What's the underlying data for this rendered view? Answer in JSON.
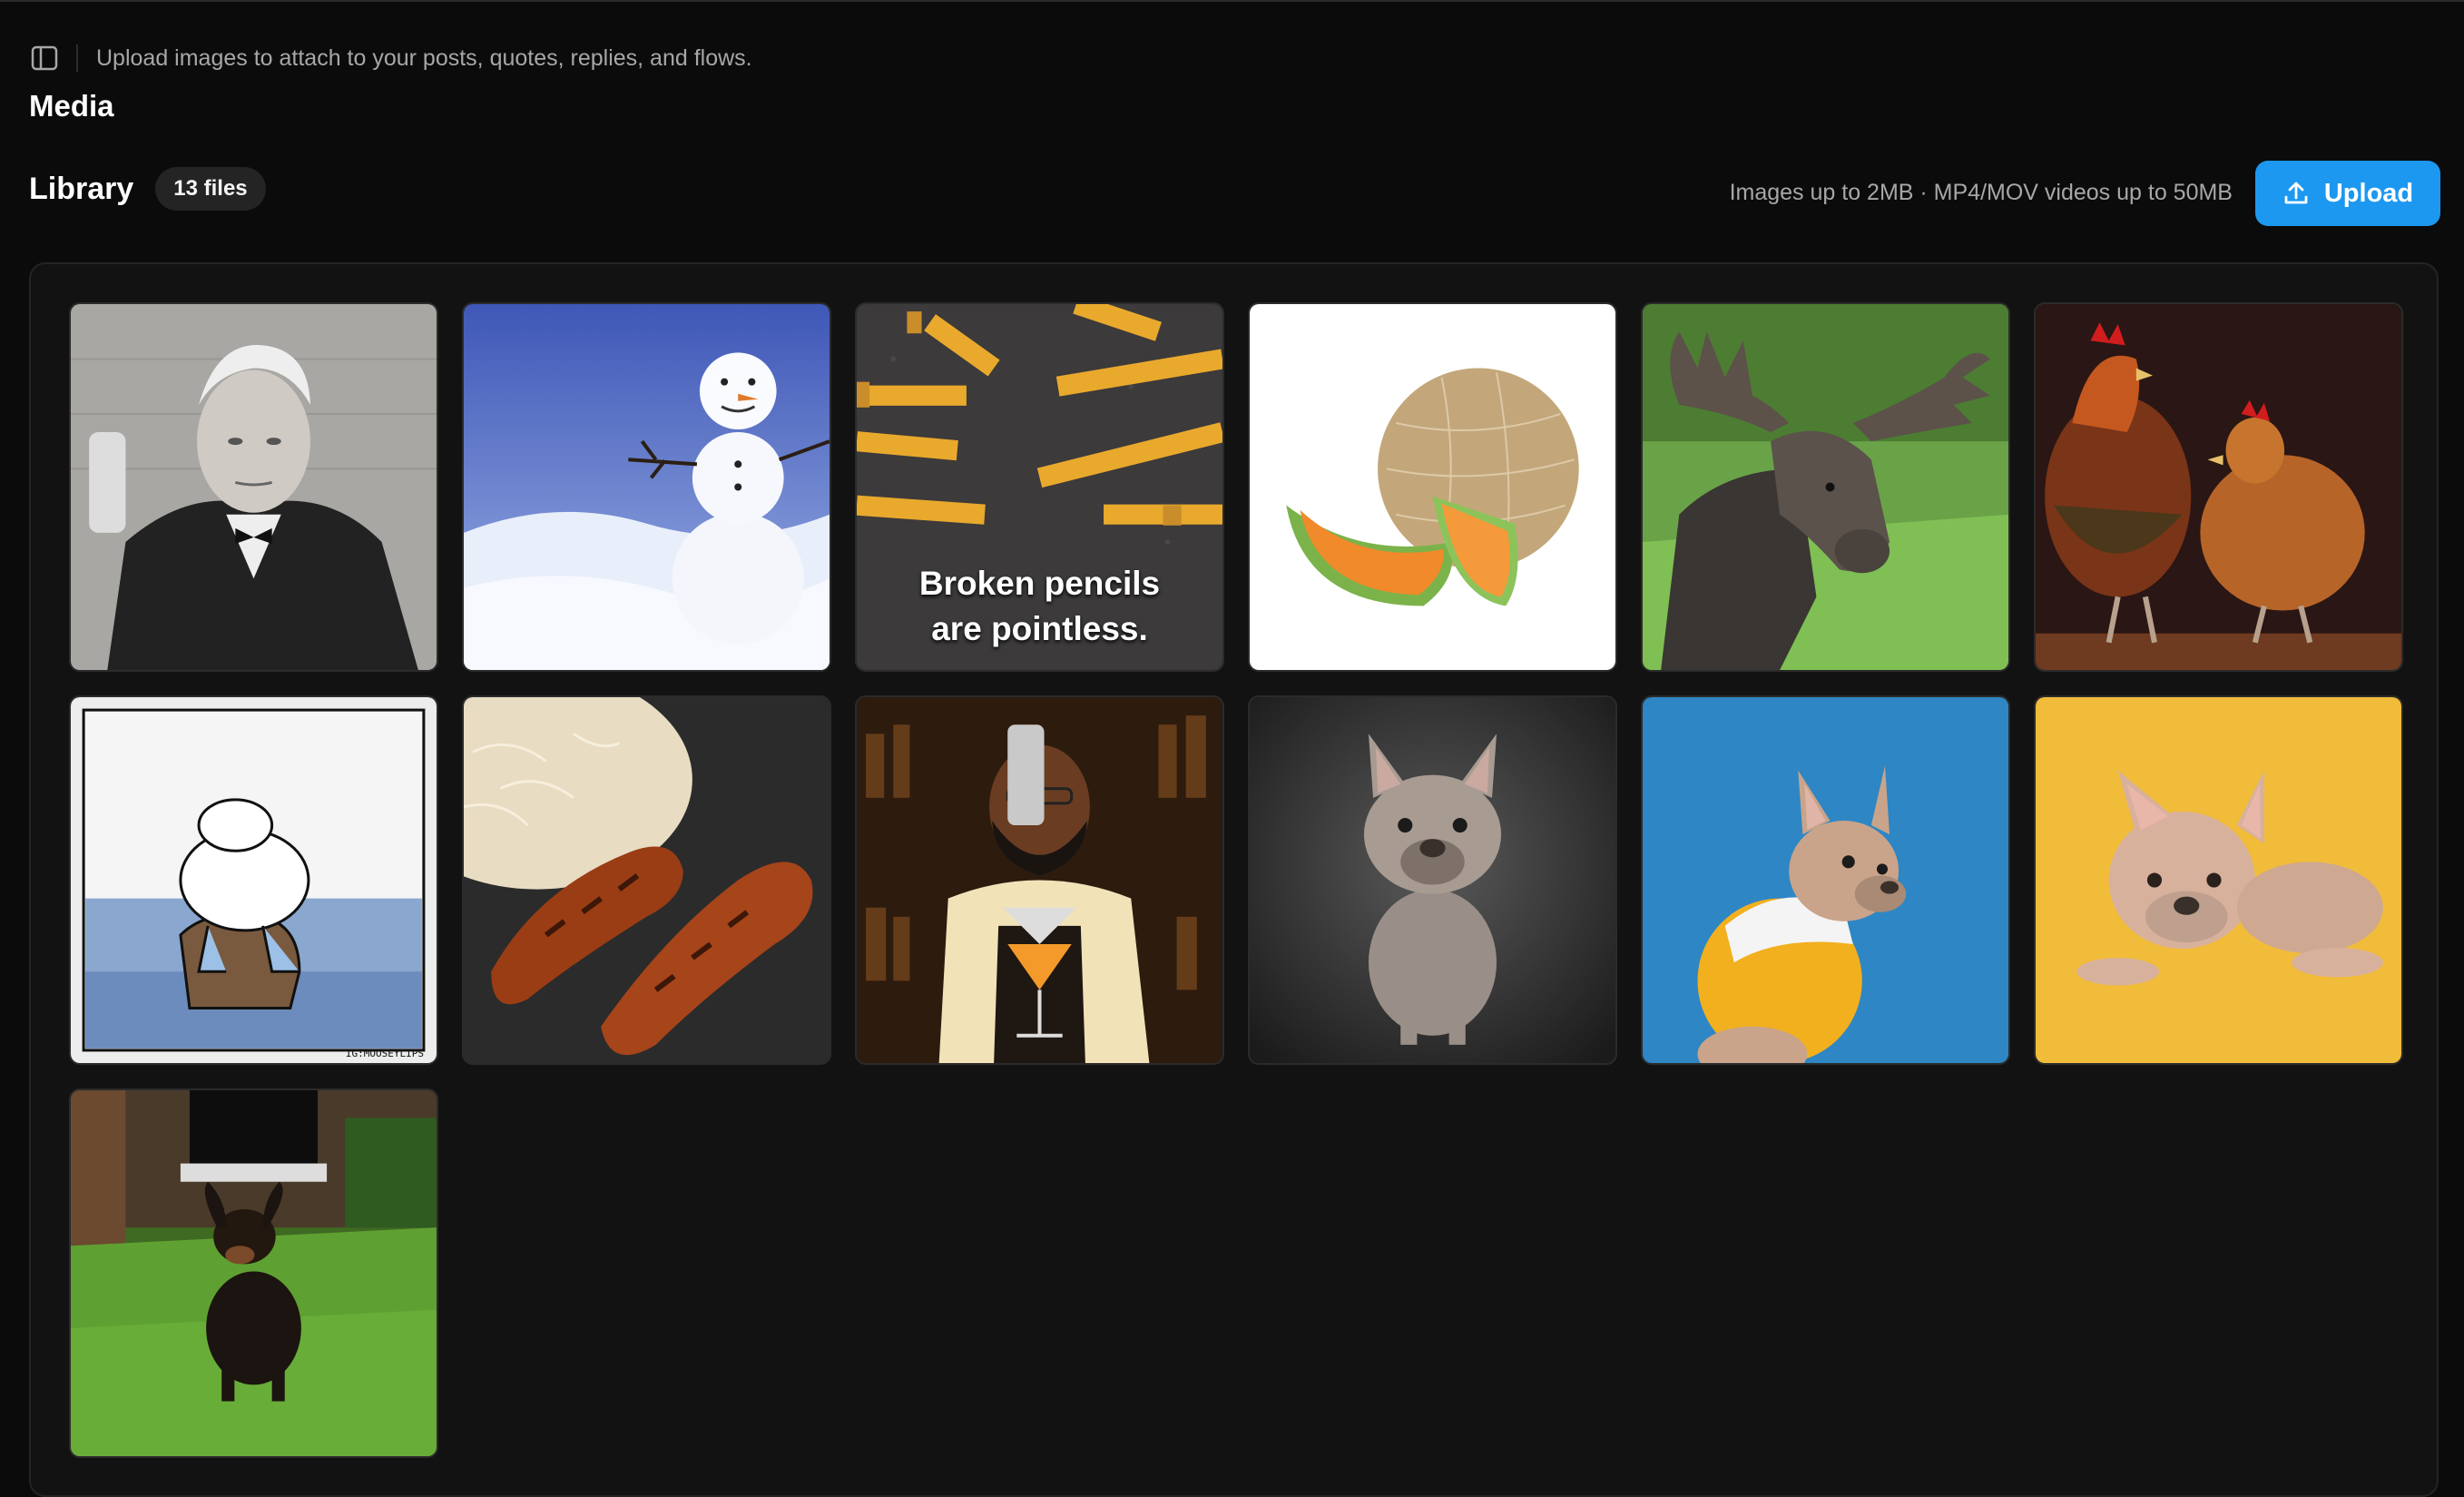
{
  "header": {
    "subtitle": "Upload images to attach to your posts, quotes, replies, and flows.",
    "title": "Media",
    "sidebar_toggle_icon": "sidebar-panel-icon"
  },
  "library": {
    "title": "Library",
    "count": "13 files",
    "limits": "Images up to 2MB · MP4/MOV videos up to 50MB",
    "upload_label": "Upload",
    "upload_icon": "upload-icon"
  },
  "colors": {
    "background": "#0b0b0b",
    "panel": "#121212",
    "accent": "#1d98f0",
    "muted_text": "#a7a7a7"
  },
  "media": [
    {
      "subject": "edison-portrait"
    },
    {
      "subject": "snowman"
    },
    {
      "subject": "broken-pencils",
      "caption_line1": "Broken pencils",
      "caption_line2": "are pointless."
    },
    {
      "subject": "cantaloupe"
    },
    {
      "subject": "moose"
    },
    {
      "subject": "chickens"
    },
    {
      "subject": "cartoon-rock",
      "watermark": "IG:MOOSEYLIPS"
    },
    {
      "subject": "sausages"
    },
    {
      "subject": "bartender"
    },
    {
      "subject": "french-bulldog-gray"
    },
    {
      "subject": "french-bulldog-hoodie"
    },
    {
      "subject": "french-bulldog-yellow"
    },
    {
      "subject": "dachshund-running"
    }
  ]
}
